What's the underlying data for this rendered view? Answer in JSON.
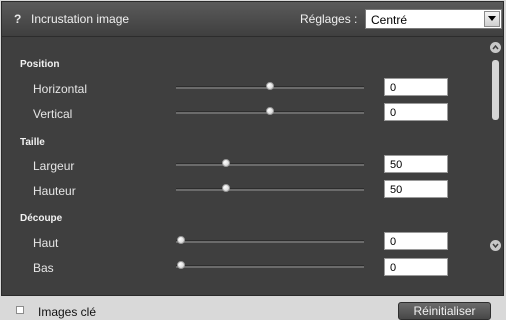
{
  "header": {
    "help_label": "?",
    "title": "Incrustation image",
    "preset_label": "Réglages :",
    "preset_value": "Centré"
  },
  "sections": {
    "position": "Position",
    "taille": "Taille",
    "decoupe": "Découpe"
  },
  "rows": {
    "horizontal": {
      "label": "Horizontal",
      "value": "0"
    },
    "vertical": {
      "label": "Vertical",
      "value": "0"
    },
    "largeur": {
      "label": "Largeur",
      "value": "50"
    },
    "hauteur": {
      "label": "Hauteur",
      "value": "50"
    },
    "haut": {
      "label": "Haut",
      "value": "0"
    },
    "bas": {
      "label": "Bas",
      "value": "0"
    }
  },
  "footer": {
    "keyframes_label": "Images clé",
    "reset_label": "Réinitialiser"
  }
}
